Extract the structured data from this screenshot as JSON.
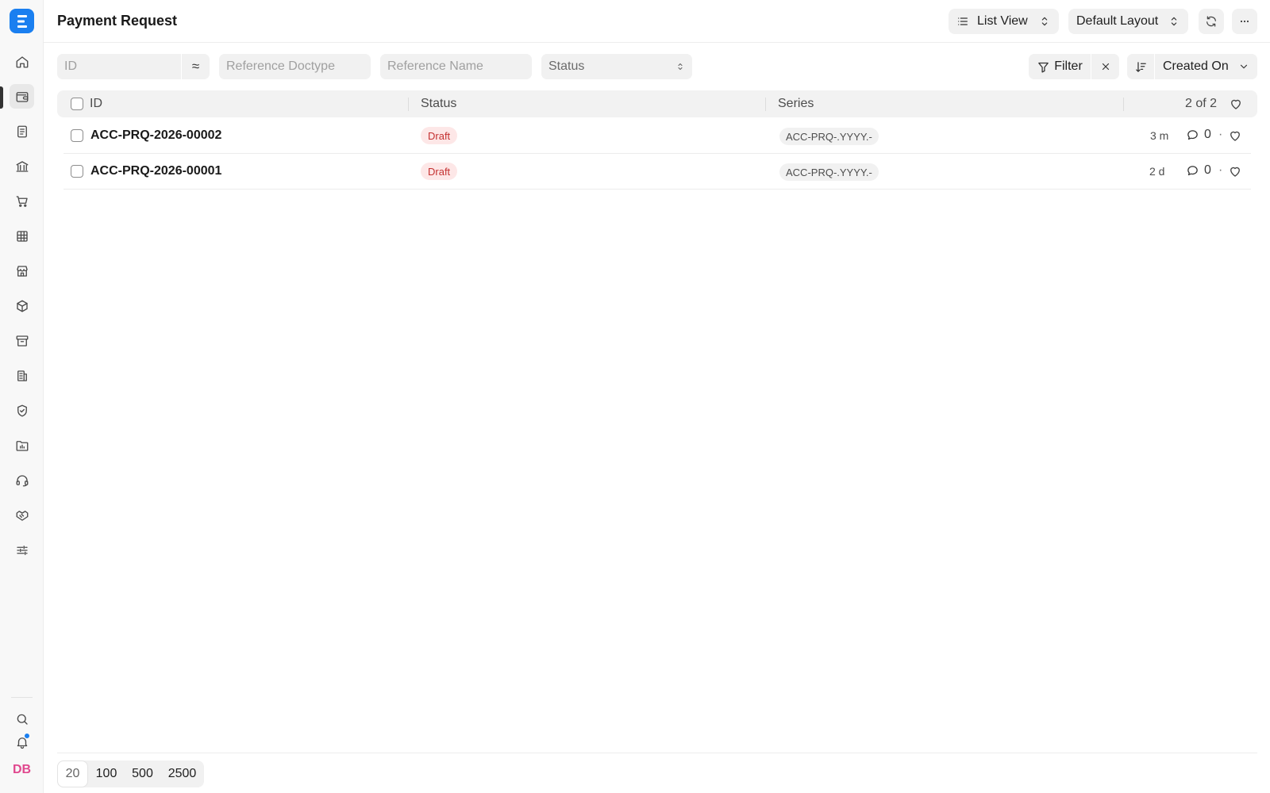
{
  "app": {
    "logo_letter": "E",
    "user_initials": "DB"
  },
  "header": {
    "title": "Payment Request",
    "view_selector_label": "List View",
    "layout_selector_label": "Default Layout"
  },
  "filters": {
    "id_placeholder": "ID",
    "id_operator": "≈",
    "reference_doctype_placeholder": "Reference Doctype",
    "reference_name_placeholder": "Reference Name",
    "status_placeholder": "Status",
    "filter_label": "Filter",
    "sort_label": "Created On"
  },
  "table": {
    "columns": [
      "ID",
      "Status",
      "Series"
    ],
    "count_label": "2 of 2",
    "rows": [
      {
        "id": "ACC-PRQ-2026-00002",
        "status": "Draft",
        "series": "ACC-PRQ-.YYYY.-",
        "modified": "3 m",
        "comments": "0"
      },
      {
        "id": "ACC-PRQ-2026-00001",
        "status": "Draft",
        "series": "ACC-PRQ-.YYYY.-",
        "modified": "2 d",
        "comments": "0"
      }
    ]
  },
  "paging": {
    "options": [
      "20",
      "100",
      "500",
      "2500"
    ],
    "selected": "20"
  },
  "colors": {
    "accent": "#1a7ff0",
    "draft_badge_bg": "#fde7e7",
    "draft_badge_text": "#c43131",
    "avatar_text": "#e0488e"
  },
  "sidebar": {
    "items": [
      {
        "icon": "home-icon"
      },
      {
        "icon": "wallet-icon",
        "active": true
      },
      {
        "icon": "document-icon"
      },
      {
        "icon": "bank-icon"
      },
      {
        "icon": "cart-icon"
      },
      {
        "icon": "table-icon"
      },
      {
        "icon": "store-icon"
      },
      {
        "icon": "box-icon"
      },
      {
        "icon": "archive-icon"
      },
      {
        "icon": "building-icon"
      },
      {
        "icon": "shield-icon"
      },
      {
        "icon": "folder-chart-icon"
      },
      {
        "icon": "headset-icon"
      },
      {
        "icon": "handshake-icon"
      },
      {
        "icon": "sliders-icon"
      }
    ],
    "bottom": [
      {
        "icon": "search-icon"
      },
      {
        "icon": "bell-icon"
      }
    ]
  }
}
